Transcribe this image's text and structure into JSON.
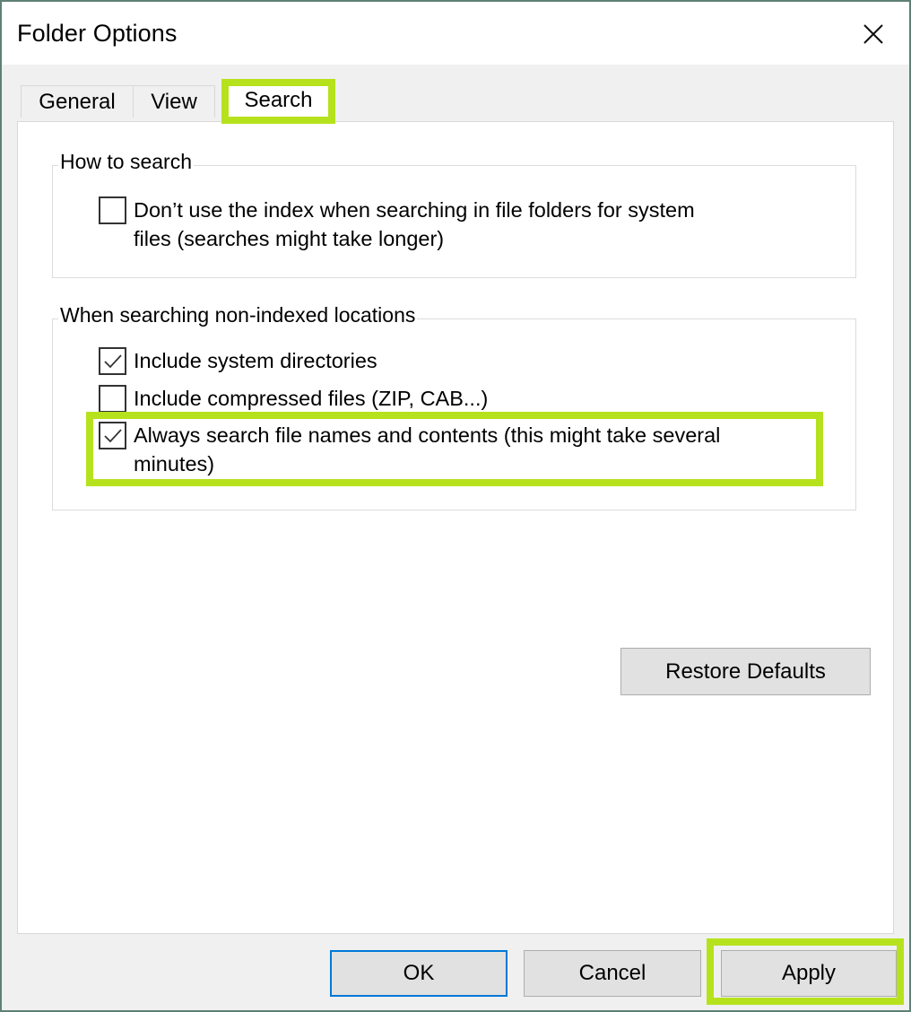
{
  "window": {
    "title": "Folder Options",
    "close_icon": "close-icon"
  },
  "tabs": [
    {
      "label": "General",
      "active": false
    },
    {
      "label": "View",
      "active": false
    },
    {
      "label": "Search",
      "active": true,
      "highlighted": true
    }
  ],
  "groups": {
    "how_to_search": {
      "legend": "How to search",
      "options": [
        {
          "label_line1": "Don’t use the index when searching in file folders for system",
          "label_line2": "files (searches might take longer)",
          "checked": false
        }
      ]
    },
    "non_indexed": {
      "legend": "When searching non-indexed locations",
      "options": [
        {
          "label": "Include system directories",
          "checked": true
        },
        {
          "label": "Include compressed files (ZIP, CAB...)",
          "checked": false
        },
        {
          "label_line1": "Always search file names and contents (this might take several",
          "label_line2": "minutes)",
          "checked": true,
          "highlighted": true
        }
      ]
    }
  },
  "buttons": {
    "restore_defaults": "Restore Defaults",
    "ok": "OK",
    "cancel": "Cancel",
    "apply": "Apply"
  },
  "colors": {
    "highlight": "#b6e21d",
    "focus_border": "#0078d7",
    "window_border": "#5f8077"
  }
}
